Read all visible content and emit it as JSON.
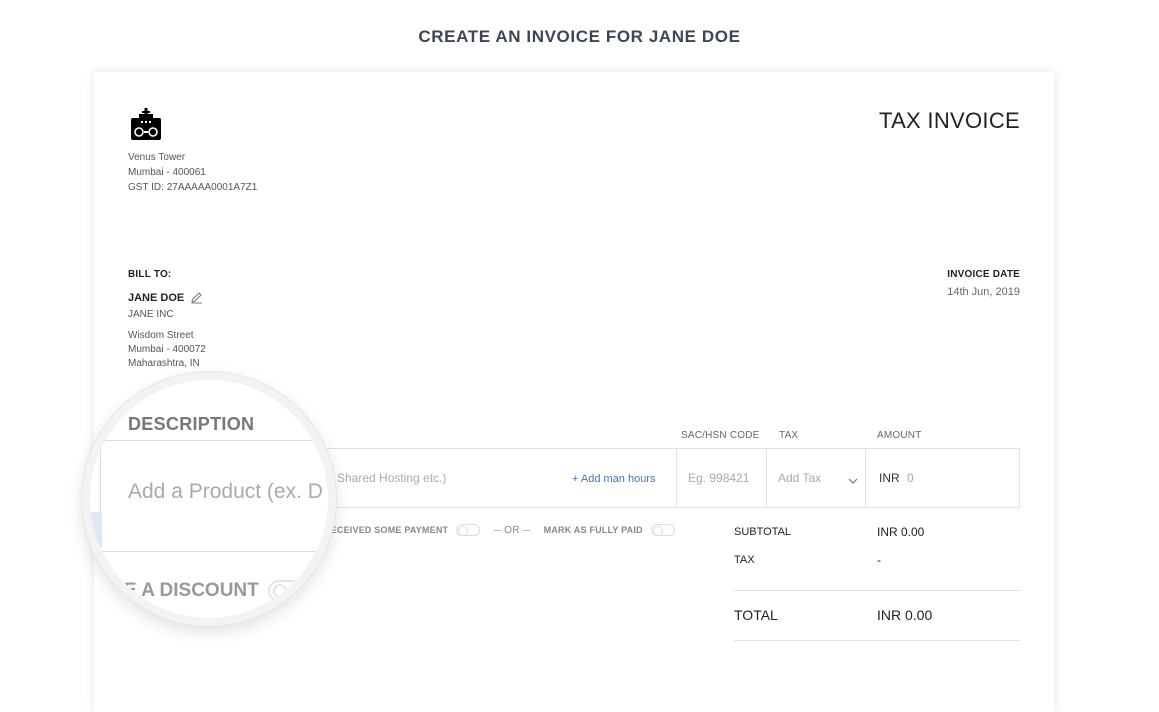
{
  "page": {
    "heading": "CREATE AN INVOICE FOR JANE DOE"
  },
  "company": {
    "address_line1": "Venus Tower",
    "address_line2": "Mumbai - 400061",
    "gst": "GST ID: 27AAAAA0001A7Z1",
    "logo_icon": "robot-radio-logo-icon"
  },
  "invoice": {
    "title": "TAX INVOICE",
    "date_label": "INVOICE DATE",
    "date_value": "14th Jun, 2019"
  },
  "bill_to": {
    "label": "BILL TO:",
    "name": "JANE DOE",
    "company": "JANE INC",
    "address_line1": "Wisdom Street",
    "address_line2": "Mumbai - 400072",
    "address_line3": "Maharashtra, IN",
    "edit_icon": "pencil-icon"
  },
  "line_items": {
    "columns": {
      "description": "DESCRIPTION",
      "code": "SAC/HSN CODE",
      "tax": "TAX",
      "amount": "AMOUNT"
    },
    "row": {
      "description_placeholder": "Shared Hosting etc.)",
      "add_hours": "+ Add man hours",
      "code_placeholder": "Eg. 998421",
      "tax_placeholder": "Add Tax",
      "currency": "INR",
      "amount_placeholder": "0"
    }
  },
  "payment": {
    "partial": "RECEIVED SOME PAYMENT",
    "or": "OR",
    "full": "MARK AS FULLY PAID"
  },
  "totals": {
    "subtotal_label": "SUBTOTAL",
    "subtotal_value": "INR 0.00",
    "tax_label": "TAX",
    "tax_value": "-",
    "total_label": "TOTAL",
    "total_value": "INR 0.00"
  },
  "magnifier": {
    "description": "DESCRIPTION",
    "placeholder": "Add a Product (ex. D",
    "discount": "E A DISCOUNT"
  }
}
